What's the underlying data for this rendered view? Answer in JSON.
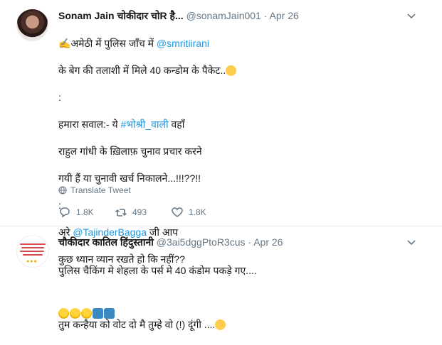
{
  "tweets": [
    {
      "name": "Sonam Jain चोकीदार चोR है...",
      "handle": "@sonamJain001",
      "time": "Apr 26",
      "line1_prefix": "अमेठी में पुलिस जाँच में ",
      "line1_mention": "@smritiirani",
      "line2": "के बेग की तलाशी में मिले 40 कन्डोम के पैकेट..",
      "colon1": ":",
      "line3_prefix": "हमारा सवाल:- ये ",
      "line3_hashtag": "#भोश्री_वाली",
      "line3_suffix": " वहाँ",
      "line4": "राहुल गांधी के ख़िलाफ़ चुनाव प्रचार करने",
      "line5": "गयी हैं या चुनावी खर्च निकालने...!!!??!!",
      "colon2": ":",
      "line6_prefix": "अरे ",
      "line6_mention": "@TajinderBagga",
      "line6_suffix": " जी आप",
      "line7": "कुछ ध्यान व्यान रखते हो कि नहीं??",
      "translate": "Translate Tweet",
      "replies": "1.8K",
      "retweets": "493",
      "likes": "1.8K"
    },
    {
      "name": "चौकीदार कातिल हिंदुस्तानी",
      "handle": "@3ai5dggPtoR3cus",
      "time": "Apr 26",
      "line1": "पुलिस चैकिंग मे शेहला के पर्स मे 40 कंडोम पकड़े गए....",
      "line2": "तुम कन्हैया को वोट दो मै तुम्हे वो (!) दूंगी ...."
    }
  ],
  "icons": [
    "caret-down-icon",
    "globe-icon",
    "reply-icon",
    "retweet-icon",
    "like-icon"
  ],
  "colors": {
    "link": "#1b95e0",
    "meta": "#657786",
    "text": "#14171a",
    "divider": "#e6ecf0"
  }
}
